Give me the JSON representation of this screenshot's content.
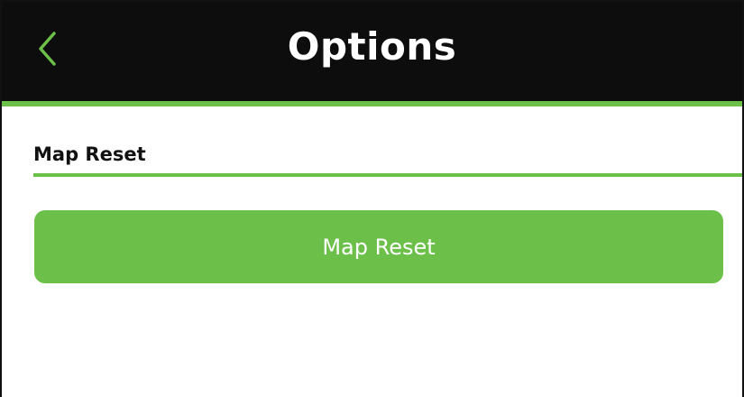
{
  "header": {
    "title": "Options",
    "back_icon": "chevron-left-icon"
  },
  "section": {
    "label": "Map Reset"
  },
  "reset_button": {
    "label": "Map Reset"
  },
  "colors": {
    "header_bg": "#0d0d0d",
    "accent": "#6cc04a",
    "title_text": "#ffffff",
    "body_bg": "#ffffff"
  }
}
